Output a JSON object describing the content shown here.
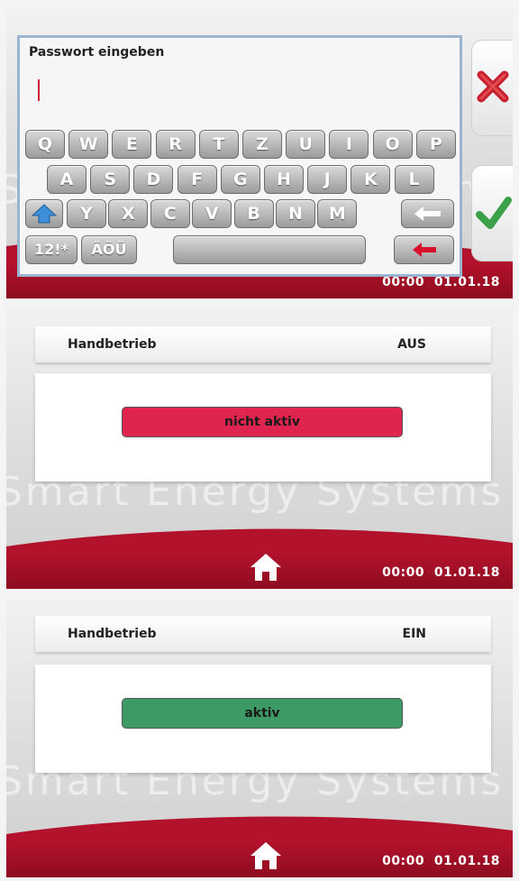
{
  "screen1": {
    "dialog_title": "Passwort eingeben",
    "password_value": "",
    "keys_row1": [
      "Q",
      "W",
      "E",
      "R",
      "T",
      "Z",
      "U",
      "I",
      "O",
      "P"
    ],
    "keys_row2": [
      "A",
      "S",
      "D",
      "F",
      "G",
      "H",
      "J",
      "K",
      "L"
    ],
    "keys_row3": [
      "Y",
      "X",
      "C",
      "V",
      "B",
      "N",
      "M"
    ],
    "key_numbers": "12!*",
    "key_umlauts": "ÄÖÜ",
    "icons": [
      "shift-icon",
      "backspace-icon",
      "enter-icon",
      "cancel-icon",
      "confirm-icon"
    ],
    "footer_time": "00:00",
    "footer_date": "01.01.18"
  },
  "screen2": {
    "label": "Handbetrieb",
    "value": "AUS",
    "button_label": "nicht aktiv",
    "button_color": "#df2450",
    "footer_time": "00:00",
    "footer_date": "01.01.18"
  },
  "screen3": {
    "label": "Handbetrieb",
    "value": "EIN",
    "button_label": "aktiv",
    "button_color": "#3e9a64",
    "footer_time": "00:00",
    "footer_date": "01.01.18"
  },
  "watermark_brand": "Smart Energy Systems",
  "colors": {
    "brand_red": "#b3122c",
    "active_green": "#3e9a64",
    "inactive_red": "#df2450"
  }
}
